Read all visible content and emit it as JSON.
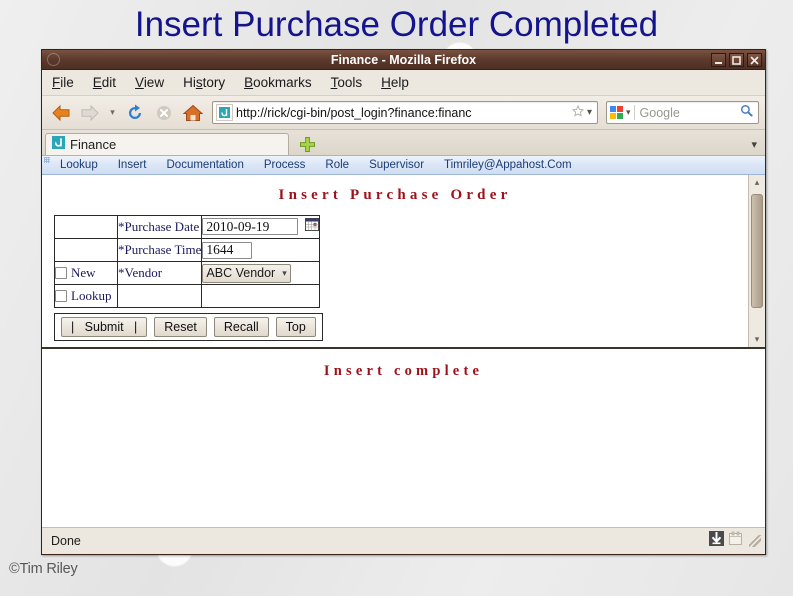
{
  "slide": {
    "title": "Insert Purchase Order Completed",
    "title_color": "#14148c",
    "copyright": "©Tim Riley"
  },
  "browser": {
    "window_title": "Finance - Mozilla Firefox",
    "titlebar_color": "#5d3a2c",
    "window_buttons": {
      "minimize": "minimize-icon",
      "maximize": "maximize-icon",
      "close": "close-icon"
    },
    "menu": [
      {
        "label": "File",
        "accel": "F"
      },
      {
        "label": "Edit",
        "accel": "E"
      },
      {
        "label": "View",
        "accel": "V"
      },
      {
        "label": "History",
        "accel": "s"
      },
      {
        "label": "Bookmarks",
        "accel": "B"
      },
      {
        "label": "Tools",
        "accel": "T"
      },
      {
        "label": "Help",
        "accel": "H"
      }
    ],
    "toolbar": {
      "back_icon": "back-arrow-icon",
      "forward_icon": "forward-arrow-icon",
      "history_dropdown_icon": "chevron-down-icon",
      "reload_icon": "reload-icon",
      "stop_icon": "stop-icon",
      "home_icon": "home-icon"
    },
    "urlbar": {
      "favicon": "site-favicon",
      "url": "http://rick/cgi-bin/post_login?finance:financ",
      "bookmark_star_icon": "star-icon",
      "dropdown_icon": "chevron-down-icon"
    },
    "search": {
      "engine": "google-icon",
      "engine_dropdown_icon": "chevron-down-icon",
      "placeholder": "Google",
      "go_icon": "magnifier-icon"
    },
    "tabs": [
      {
        "label": "Finance",
        "favicon": "finance-favicon",
        "active": true
      }
    ],
    "new_tab_icon": "plus-icon",
    "tab_list_icon": "chevron-down-icon",
    "statusbar": {
      "text": "Done",
      "download_icon": "download-arrow-icon",
      "notes_icon": "notes-icon"
    }
  },
  "page": {
    "appnav": [
      "Lookup",
      "Insert",
      "Documentation",
      "Process",
      "Role",
      "Supervisor",
      "Timriley@Appahost.Com"
    ],
    "heading": "Insert Purchase Order",
    "heading_color": "#9e1119",
    "form": {
      "rows": [
        {
          "checkbox": null,
          "label": "*Purchase Date",
          "field_type": "text",
          "value": "2010-09-19",
          "extra_icon": "calendar-picker-icon"
        },
        {
          "checkbox": null,
          "label": "*Purchase Time",
          "field_type": "text",
          "value": "1644",
          "extra_icon": null
        },
        {
          "checkbox": "New",
          "label": "*Vendor",
          "field_type": "select",
          "value": "ABC Vendor",
          "options": [
            "ABC Vendor"
          ],
          "extra_icon": null
        },
        {
          "checkbox": "Lookup",
          "label": "",
          "field_type": null,
          "value": "",
          "extra_icon": null
        }
      ],
      "buttons": [
        "|   Submit   |",
        "Reset",
        "Recall",
        "Top"
      ]
    },
    "result": "Insert complete",
    "result_color": "#9e1119"
  }
}
